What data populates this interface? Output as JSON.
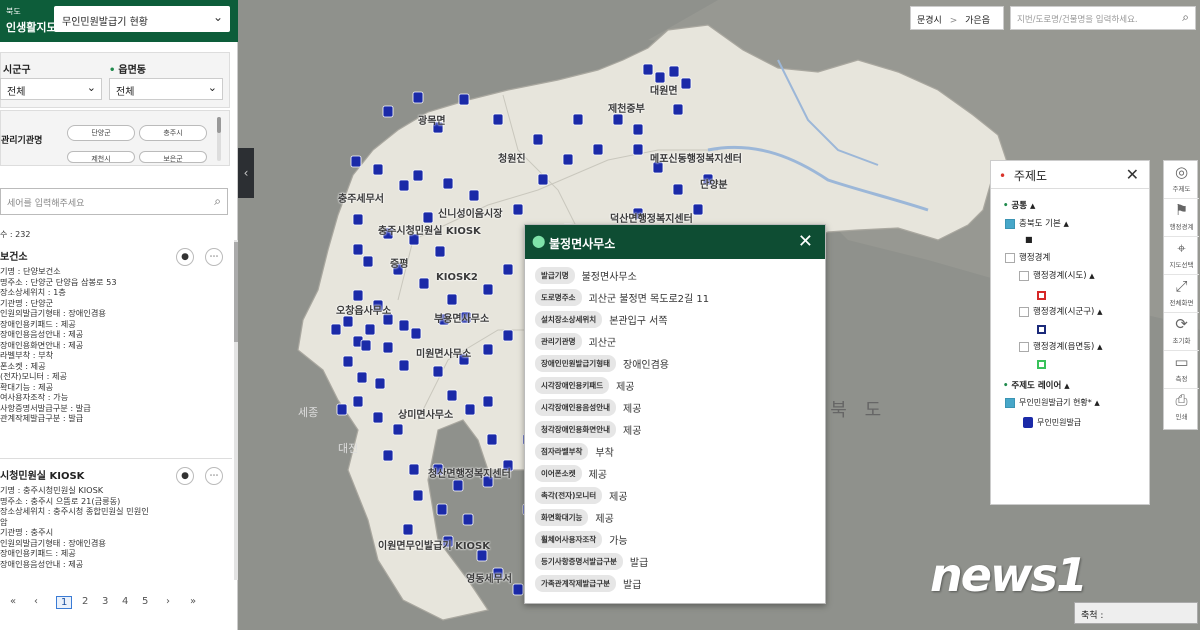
{
  "header": {
    "sub_label": "북도",
    "title": "인생활지도",
    "layer_select": "무인민원발급기 현황"
  },
  "filters": {
    "sigungu_label": "시군구",
    "sigungu_value": "전체",
    "eupmyeondong_label": "읍면동",
    "eupmyeondong_value": "전체",
    "org_label": "관리기관명",
    "org_chips": [
      "단양군",
      "충주시",
      "제천시",
      "보은군"
    ]
  },
  "search": {
    "placeholder": "세어를 입력해주세요"
  },
  "result_count": "수 : 232",
  "list": [
    {
      "title": "보건소",
      "lines": [
        "기명 : 단양보건소",
        "명주소 : 단양군 단양읍 삼봉로 53",
        "장소상세위치 : 1층",
        "기관명 : 단양군",
        "인원의발급기형태 : 장애인겸용",
        "장애인용키패드 : 제공",
        "장애인용음성안내 : 제공",
        "장애인용화면안내 : 제공",
        "라벨부착 : 부착",
        "폰소켓 : 제공",
        "(전자)모니터 : 제공",
        "확대기능 : 제공",
        "여사용자조작 : 가능",
        "사항증명서발급구분 : 발급",
        "관계작제발급구분 : 발급"
      ]
    },
    {
      "title": "시청민원실 KIOSK",
      "lines": [
        "기명 : 충주시청민원실 KIOSK",
        "명주소 : 충주시 으뜸로 21(금릉동)",
        "장소상세위치 : 충주시청 종합민원실 민원인",
        "  암",
        "기관명 : 충주시",
        "인원의발급기형태 : 장애인겸용",
        "장애인용키패드 : 제공",
        "장애인용음성안내 : 제공"
      ]
    }
  ],
  "pager": {
    "first": "«",
    "prev": "‹",
    "pages": [
      "1",
      "2",
      "3",
      "4",
      "5"
    ],
    "next": "›",
    "last": "»",
    "current": "1"
  },
  "topbar": {
    "region_city": "문경시",
    "region_sep": ">",
    "region_dong": "가은읍",
    "address_placeholder": "지번/도로명/건물명을 입력하세요."
  },
  "theme_panel": {
    "title": "주제도",
    "common_label": "공통",
    "base_label": "충북도 기본",
    "admin_label": "행정경계",
    "admin_sido": "행정경계(시도)",
    "admin_sigungu": "행정경계(시군구)",
    "admin_emd": "행정경계(읍면동)",
    "layer_label": "주제도 레이어",
    "layer_item": "무인민원발급기 현황*",
    "legend_item": "무인민원발급",
    "colors": {
      "sido": "#d62828",
      "sigungu": "#1b2a7a",
      "emd": "#38c25a"
    }
  },
  "toolbar": [
    {
      "label": "주제도",
      "icon": "globe-icon"
    },
    {
      "label": "행정경계",
      "icon": "flag-icon"
    },
    {
      "label": "지도선택",
      "icon": "map-pin-icon"
    },
    {
      "label": "전체화면",
      "icon": "fullscreen-icon"
    },
    {
      "label": "초기화",
      "icon": "refresh-icon"
    },
    {
      "label": "측정",
      "icon": "ruler-icon"
    },
    {
      "label": "인쇄",
      "icon": "print-icon"
    }
  ],
  "popup": {
    "title": "불정면사무소",
    "rows": [
      {
        "key": "발급기명",
        "value": "불정면사무소"
      },
      {
        "key": "도로명주소",
        "value": "괴산군 불정면 목도로2길 11"
      },
      {
        "key": "설치장소상세위치",
        "value": "본관입구 서쪽"
      },
      {
        "key": "관리기관명",
        "value": "괴산군"
      },
      {
        "key": "장애인민원발급기형태",
        "value": "장애인겸용"
      },
      {
        "key": "시각장애인용키패드",
        "value": "제공"
      },
      {
        "key": "시각장애인용음성안내",
        "value": "제공"
      },
      {
        "key": "청각장애인용화면안내",
        "value": "제공"
      },
      {
        "key": "점자라벨부착",
        "value": "부착"
      },
      {
        "key": "이어폰소켓",
        "value": "제공"
      },
      {
        "key": "촉각(전자)모니터",
        "value": "제공"
      },
      {
        "key": "화면확대기능",
        "value": "제공"
      },
      {
        "key": "휠체어사용자조작",
        "value": "가능"
      },
      {
        "key": "등기사항증명서발급구분",
        "value": "발급"
      },
      {
        "key": "가족관계작제발급구분",
        "value": "발급"
      }
    ]
  },
  "map_labels": [
    "대전",
    "세종",
    "상 북 도",
    "광목면",
    "충주시청민원실 KIOSK",
    "증평",
    "KIOSK2",
    "오창읍사무소",
    "부용면사무소",
    "미원면사무소",
    "상미면사무소",
    "청산면행정복지센터",
    "이원면무인발급기 KIOSK",
    "영동세무서",
    "대원면",
    "제천중부",
    "메포신동행정복지센터",
    "단양분",
    "덕산면행정복지센터",
    "청원진",
    "충주세무서",
    "신니성이음시장"
  ],
  "scale": {
    "label": "축척 :"
  },
  "watermark": "news1",
  "map_colors": {
    "province": "#e7e5dc",
    "outside": "#8f918c",
    "pin": "#1b2aa8",
    "popup_header": "#0e4d33",
    "brand": "#0d5d3a"
  }
}
